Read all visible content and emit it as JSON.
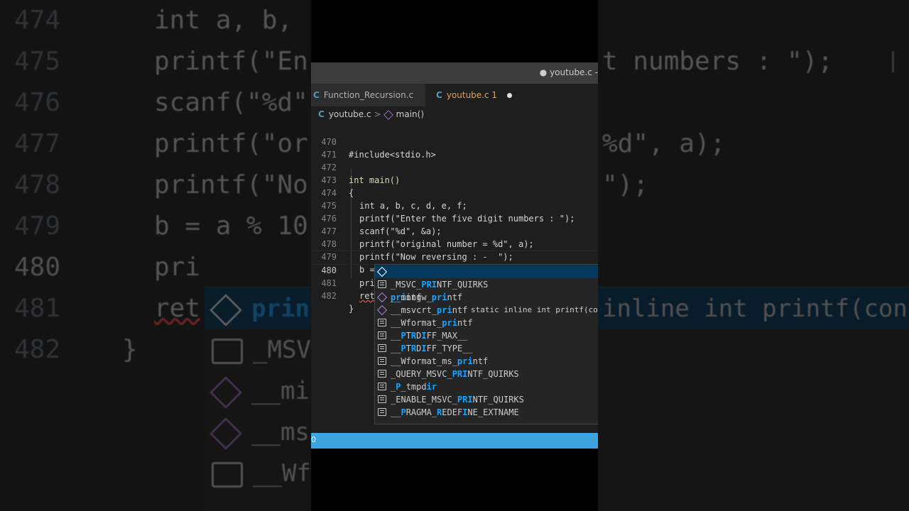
{
  "window": {
    "title": "● youtube.c -"
  },
  "tabs": [
    {
      "icon": "C",
      "label": "Function_Recursion.c",
      "active": false
    },
    {
      "icon": "C",
      "label": "youtube.c 1",
      "active": true,
      "modified": true
    }
  ],
  "breadcrumb": {
    "file": "youtube.c",
    "symbol": "main()"
  },
  "editor": {
    "lines": [
      {
        "no": "470",
        "text": "#include<stdio.h>"
      },
      {
        "no": "471",
        "text": ""
      },
      {
        "no": "472",
        "text": "int main()"
      },
      {
        "no": "473",
        "text": "{"
      },
      {
        "no": "474",
        "text": "int a, b, c, d, e, f;"
      },
      {
        "no": "475",
        "text": "printf(\"Enter the five digit numbers : \");"
      },
      {
        "no": "476",
        "text": "scanf(\"%d\", &a);"
      },
      {
        "no": "477",
        "text": "printf(\"original number = %d\", a);"
      },
      {
        "no": "478",
        "text": "printf(\"Now reversing : -  \");"
      },
      {
        "no": "479",
        "text": "b = a % 10;"
      },
      {
        "no": "480",
        "text": "pri"
      },
      {
        "no": "481",
        "text": "ret"
      },
      {
        "no": "482",
        "text": "}"
      }
    ]
  },
  "suggestions": {
    "detail": "static inline int printf(cons",
    "items": [
      {
        "kind": "cube-icon",
        "label": "printf",
        "selected": true
      },
      {
        "kind": "constant-icon",
        "label": "_MSVC_PRINTF_QUIRKS"
      },
      {
        "kind": "cube-icon",
        "label": "__mingw_printf"
      },
      {
        "kind": "cube-icon",
        "label": "__msvcrt_printf"
      },
      {
        "kind": "constant-icon",
        "label": "__Wformat_printf"
      },
      {
        "kind": "constant-icon",
        "label": "__PTRDIFF_MAX__"
      },
      {
        "kind": "constant-icon",
        "label": "__PTRDIFF_TYPE__"
      },
      {
        "kind": "constant-icon",
        "label": "__Wformat_ms_printf"
      },
      {
        "kind": "constant-icon",
        "label": "_QUERY_MSVC_PRINTF_QUIRKS"
      },
      {
        "kind": "constant-icon",
        "label": "_P_tmpdir"
      },
      {
        "kind": "constant-icon",
        "label": "_ENABLE_MSVC_PRINTF_QUIRKS"
      },
      {
        "kind": "constant-icon",
        "label": "__PRAGMA_REDEFINE_EXTNAME"
      }
    ]
  },
  "statusbar": {
    "text": "0"
  },
  "background_zoom": {
    "line_numbers": [
      "474",
      "475",
      "476",
      "477",
      "478",
      "479",
      "480",
      "481",
      "482"
    ],
    "code": [
      "int a, b,",
      "printf(\"En",
      "scanf(\"%d\"",
      "printf(\"or",
      "printf(\"No",
      "b = a % 10",
      "pri",
      "ret",
      "}"
    ],
    "right_fragments": [
      "t numbers : \");",
      "%d\", a);",
      "\");",
      "inline int printf(cons"
    ],
    "suggest_labels": [
      "prin",
      "_MSV",
      "__mi",
      "__ms",
      "__Wf"
    ]
  },
  "colors": {
    "accent": "#3fa5e0",
    "highlight": "#18a3ff",
    "selection": "#04395e"
  }
}
